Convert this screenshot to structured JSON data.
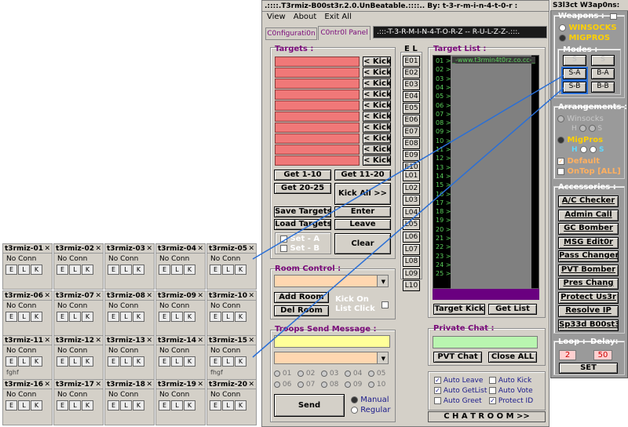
{
  "mini_windows": [
    {
      "title": "t3rmiz-01",
      "status": "No Conn",
      "name": ""
    },
    {
      "title": "t3rmiz-02",
      "status": "No Conn",
      "name": ""
    },
    {
      "title": "t3rmiz-03",
      "status": "No Conn",
      "name": ""
    },
    {
      "title": "t3rmiz-04",
      "status": "No Conn",
      "name": ""
    },
    {
      "title": "t3rmiz-05",
      "status": "No Conn",
      "name": ""
    },
    {
      "title": "t3rmiz-06",
      "status": "No Conn",
      "name": ""
    },
    {
      "title": "t3rmiz-07",
      "status": "No Conn",
      "name": ""
    },
    {
      "title": "t3rmiz-08",
      "status": "No Conn",
      "name": ""
    },
    {
      "title": "t3rmiz-09",
      "status": "No Conn",
      "name": ""
    },
    {
      "title": "t3rmiz-10",
      "status": "No Conn",
      "name": ""
    },
    {
      "title": "t3rmiz-11",
      "status": "No Conn",
      "name": "fghf"
    },
    {
      "title": "t3rmiz-12",
      "status": "No Conn",
      "name": ""
    },
    {
      "title": "t3rmiz-13",
      "status": "No Conn",
      "name": ""
    },
    {
      "title": "t3rmiz-14",
      "status": "No Conn",
      "name": ""
    },
    {
      "title": "t3rmiz-15",
      "status": "No Conn",
      "name": "fhgf"
    },
    {
      "title": "t3rmiz-16",
      "status": "No Conn",
      "name": ""
    },
    {
      "title": "t3rmiz-17",
      "status": "No Conn",
      "name": ""
    },
    {
      "title": "t3rmiz-18",
      "status": "No Conn",
      "name": ""
    },
    {
      "title": "t3rmiz-19",
      "status": "No Conn",
      "name": ""
    },
    {
      "title": "t3rmiz-20",
      "status": "No Conn",
      "name": ""
    }
  ],
  "mini_keys": {
    "e": "E",
    "l": "L",
    "k": "K"
  },
  "main": {
    "title": ".::::.T3rmiz-B00st3r.2.0.UnBeatable.::::.. By: t-3-r-m-i-n-4-t-0-r :",
    "menu": [
      "View",
      "About",
      "Exit All"
    ],
    "tabs": [
      "C0nfigurati0n",
      "C0ntr0l Panel"
    ],
    "banner": ".:::-T-3-R-M-I-N-4-T-O-R-Z -- R-U-L-Z-Z-.:::.",
    "targets_label": "Targets :",
    "kick_label": "< Kick",
    "el_label": "E  L",
    "e_buttons": [
      "E01",
      "E02",
      "E03",
      "E04",
      "E05",
      "E06",
      "E07",
      "E08",
      "E09",
      "E10"
    ],
    "l_buttons": [
      "L01",
      "L02",
      "L03",
      "L04",
      "L05",
      "L06",
      "L07",
      "L08",
      "L09",
      "L10"
    ],
    "target_list_label": "Target List :",
    "target_list_lines": [
      "01 >",
      "02 >",
      "03 >",
      "04 >",
      "05 >",
      "06 >",
      "07 >",
      "08 >",
      "09 >",
      "10 >",
      "11 >",
      "12 >",
      "13 >",
      "14 >",
      "15 >",
      "16 >",
      "17 >",
      "18 >",
      "19 >",
      "20 >",
      "21 >",
      "22 >",
      "23 >",
      "24 >",
      "25 >"
    ],
    "target_list_url": "_-www.t3rmin4t0rz.co.cc-_",
    "get_1_10": "Get 1-10",
    "get_11_20": "Get 11-20",
    "get_20_25": "Get 20-25",
    "kick_all": "Kick All >>",
    "save_targets": "Save Targets",
    "load_targets": "Load Targets",
    "enter": "Enter",
    "leave": "Leave",
    "set_a": "Set - A",
    "set_b": "Set - B",
    "clear": "Clear",
    "target_kick": "Target Kick",
    "get_list": "Get List",
    "room_control_label": "Room Control :",
    "add_room": "Add Room",
    "del_room": "Del Room",
    "kick_on_list_click": "Kick On List Click",
    "troops_label": "Troops Send  Message :",
    "radio_numbers": [
      "01",
      "02",
      "03",
      "04",
      "05",
      "06",
      "07",
      "08",
      "09",
      "10"
    ],
    "send": "Send",
    "manual": "Manual",
    "regular": "Regular",
    "private_chat_label": "Private Chat :",
    "pvt_chat": "PVT Chat",
    "close_all": "Close ALL",
    "auto_checks": [
      "Auto Leave",
      "Auto Kick",
      "Auto GetList",
      "Auto Vote",
      "Auto Greet",
      "Protect ID"
    ],
    "chat_room": "C H A T  R O O M >>"
  },
  "right": {
    "title": "S3l3ct W3ap0ns:",
    "weapons_label": "Weapons :",
    "winsocks": "WINSOCKS",
    "migpros": "MIGPROS",
    "modes_label": "Modes :",
    "modes": [
      "S",
      "S",
      "S-A",
      "B-A",
      "S-B",
      "B-B"
    ],
    "arrangements_label": "Arrangements :",
    "winsocks_grey": "Winsocks",
    "h": "H",
    "s": "S",
    "migpros2": "MigPros",
    "default": "Default",
    "ontop": "OnTop [ALL]",
    "accessories_label": "Accessories :",
    "accessories": [
      "A/C Checker",
      "Admin Call",
      "GC Bomber",
      "MSG Edit0r",
      "Pass Changer",
      "PVT Bomber",
      "Pres Chang",
      "Protect Us3r",
      "Resolve IP",
      "Sp33d B00st3r"
    ],
    "loop_label": "Loop :",
    "delay_label": "Delay:",
    "loop_value": "2",
    "delay_value": "50",
    "set": "SET"
  },
  "colors": {
    "accent_pink": "#f07878",
    "purple": "#7a0a7a",
    "green_text": "#5cd25c"
  }
}
